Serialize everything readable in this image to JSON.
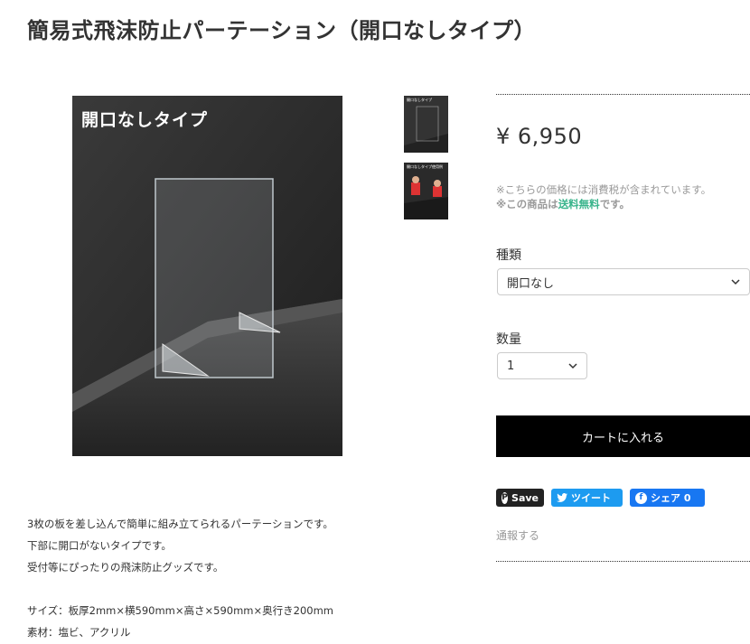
{
  "product": {
    "title": "簡易式飛沫防止パーテーション（開口なしタイプ）",
    "price": "¥ 6,950",
    "tax_note": "※こちらの価格には消費税が含まれています。",
    "shipping_prefix": "※この商品は",
    "shipping_free": "送料無料",
    "shipping_suffix": "です。"
  },
  "image": {
    "caption": "開口なしタイプ",
    "thumb1_caption": "開口なしタイプ",
    "thumb2_caption": "開口なしタイプ使用例"
  },
  "options": {
    "type_label": "種類",
    "type_value": "開口なし",
    "qty_label": "数量",
    "qty_value": "1"
  },
  "actions": {
    "cart_button": "カートに入れる",
    "pinterest": "Save",
    "tweet": "ツイート",
    "facebook": "シェア 0",
    "report": "通報する"
  },
  "description": {
    "lines": [
      "3枚の板を差し込んで簡単に組み立てられるパーテーションです。",
      "下部に開口がないタイプです。",
      "受付等にぴったりの飛沫防止グッズです。",
      "",
      "サイズ：板厚2mm×横590mm×高さ×590mm×奥行き200mm",
      "素材：塩ビ、アクリル"
    ]
  },
  "colors": {
    "accent_free_shipping": "#38b48b",
    "cart_button_bg": "#000000",
    "twitter": "#1d9bf0",
    "facebook": "#1877f2",
    "pinterest": "#222222"
  }
}
